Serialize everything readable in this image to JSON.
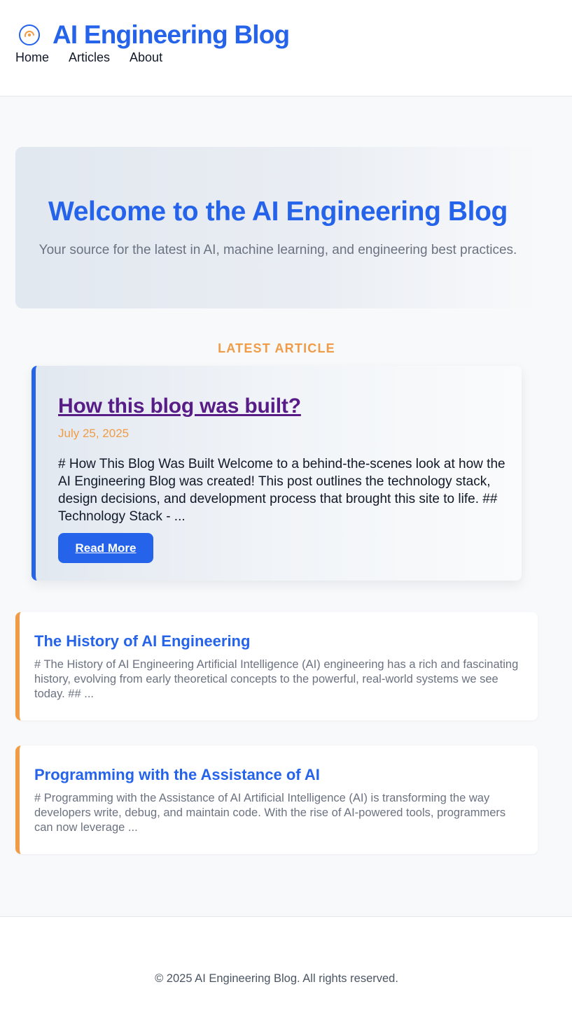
{
  "header": {
    "brand_title": "AI Engineering Blog",
    "logo_icon": "circle-target-icon",
    "nav": [
      {
        "label": "Home"
      },
      {
        "label": "Articles"
      },
      {
        "label": "About"
      }
    ]
  },
  "hero": {
    "title": "Welcome to the AI Engineering Blog",
    "subtitle": "Your source for the latest in AI, machine learning, and engineering best practices."
  },
  "latest": {
    "label": "LATEST ARTICLE",
    "title": "How this blog was built?",
    "date": "July 25, 2025",
    "excerpt": "# How This Blog Was Built Welcome to a behind-the-scenes look at how the AI Engineering Blog was created! This post outlines the technology stack, design decisions, and development process that brought this site to life. ## Technology Stack - ...",
    "read_more_label": "Read More"
  },
  "articles": [
    {
      "title": "The History of AI Engineering",
      "excerpt": "# The History of AI Engineering Artificial Intelligence (AI) engineering has a rich and fascinating history, evolving from early theoretical concepts to the powerful, real-world systems we see today. ## ..."
    },
    {
      "title": "Programming with the Assistance of AI",
      "excerpt": "# Programming with the Assistance of AI Artificial Intelligence (AI) is transforming the way developers write, debug, and maintain code. With the rise of AI-powered tools, programmers can now leverage ..."
    }
  ],
  "footer": {
    "copyright": "© 2025 AI Engineering Blog. All rights reserved."
  },
  "colors": {
    "primary": "#2563eb",
    "accent": "#f09c46",
    "visited_link": "#581c87",
    "muted_text": "#6b7280"
  }
}
